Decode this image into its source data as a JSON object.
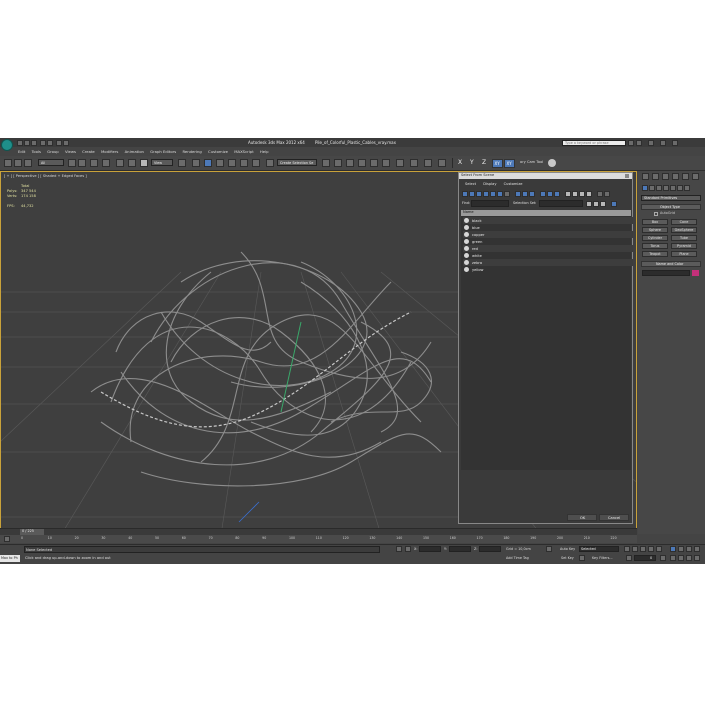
{
  "app": {
    "title": "Autodesk 3ds Max  2012 x64",
    "file": "Pile_of_Colorful_Plastic_Cables_vray.max",
    "search_placeholder": "Type a keyword or phrase"
  },
  "menu": [
    "Edit",
    "Tools",
    "Group",
    "Views",
    "Create",
    "Modifiers",
    "Animation",
    "Graph Editors",
    "Rendering",
    "Customize",
    "MAXScript",
    "Help"
  ],
  "toolbar": {
    "layer_value": "All",
    "view_value": "View",
    "selection_set": "Create Selection Se",
    "axis_x": "X",
    "axis_y": "Y",
    "axis_z": "Z",
    "axis_xy": "XY",
    "axis_xy2": "XY",
    "camera_tool": "ory Cam Tool"
  },
  "viewport": {
    "label": "[ + ] [ Perspective ] [ Shaded + Edged Faces ]",
    "stats_title": "Total",
    "polys_label": "Polys:",
    "polys_value": "347 544",
    "verts_label": "Verts:",
    "verts_value": "174 158",
    "fps_label": "FPS:",
    "fps_value": "44,732"
  },
  "dialog": {
    "title": "Select From Scene",
    "menu": [
      "Select",
      "Display",
      "Customize"
    ],
    "find_label": "Find:",
    "selection_set_label": "Selection Set:",
    "column_name": "Name",
    "objects": [
      "black",
      "blue",
      "copper",
      "green",
      "red",
      "white",
      "zebra",
      "yellow"
    ],
    "ok": "OK",
    "cancel": "Cancel"
  },
  "command_panel": {
    "dropdown": "Standard Primitives",
    "object_type_title": "Object Type",
    "autogrid": "AutoGrid",
    "buttons": [
      "Box",
      "Cone",
      "Sphere",
      "GeoSphere",
      "Cylinder",
      "Tube",
      "Torus",
      "Pyramid",
      "Teapot",
      "Plane"
    ],
    "name_color_title": "Name and Color",
    "accent": "#c4307a"
  },
  "timeline": {
    "frame_counter": "0 / 225",
    "ticks": [
      "0",
      "10",
      "20",
      "30",
      "40",
      "50",
      "60",
      "70",
      "80",
      "90",
      "100",
      "110",
      "120",
      "130",
      "140",
      "150",
      "160",
      "170",
      "180",
      "190",
      "200",
      "210",
      "220"
    ]
  },
  "status": {
    "welcome": "Max to Ph",
    "selected": "None Selected",
    "prompt": "Click and drag up-and-down to zoom in and out",
    "x_label": "X:",
    "y_label": "Y:",
    "z_label": "Z:",
    "grid": "Grid = 10,0cm",
    "auto_key": "Auto Key",
    "key_mode": "Selected",
    "set_key": "Set Key",
    "key_filters": "Key Filters...",
    "add_time_tag": "Add Time Tag",
    "frame": "0"
  }
}
